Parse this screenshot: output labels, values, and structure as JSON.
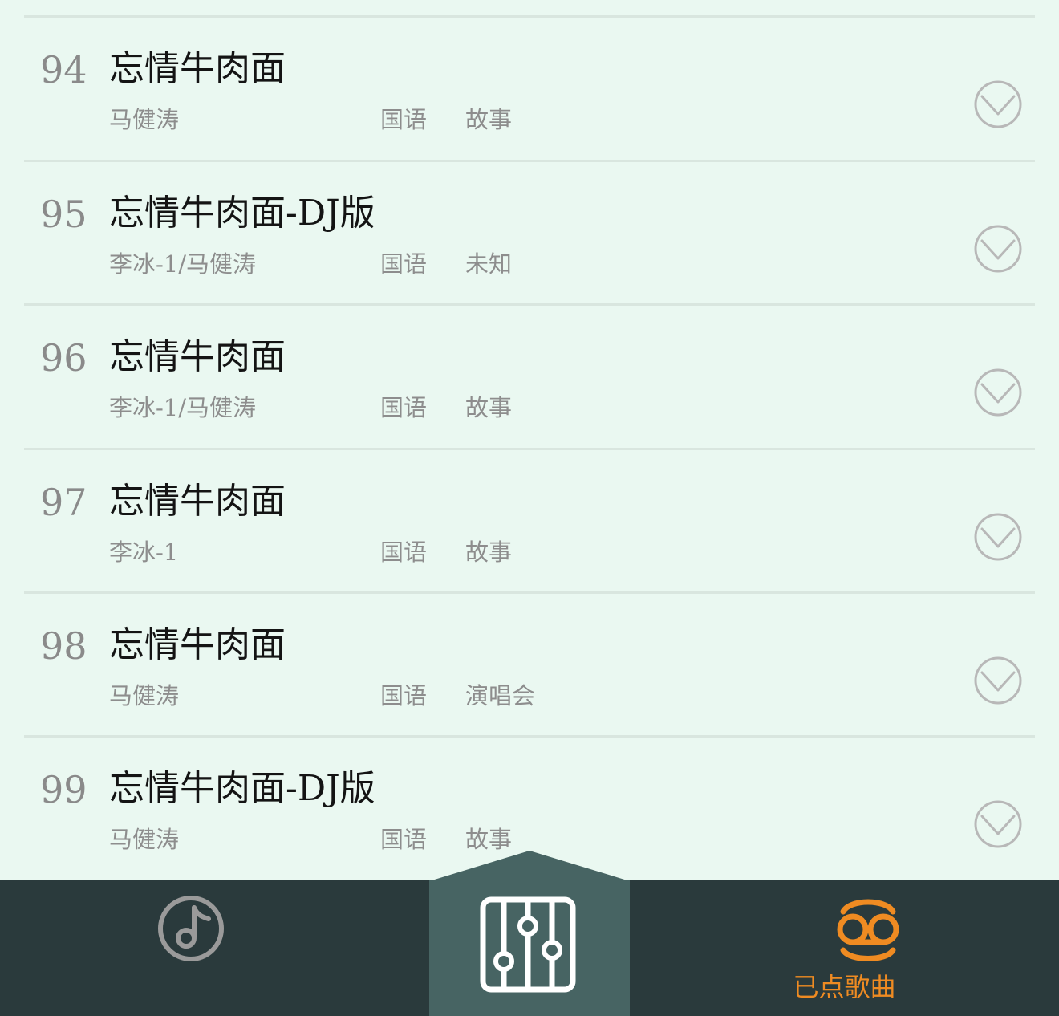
{
  "songs": [
    {
      "num": "94",
      "title": "忘情牛肉面",
      "artist": "马健涛",
      "language": "国语",
      "tag": "故事"
    },
    {
      "num": "95",
      "title": "忘情牛肉面-DJ版",
      "artist": "李冰-1/马健涛",
      "language": "国语",
      "tag": "未知"
    },
    {
      "num": "96",
      "title": "忘情牛肉面",
      "artist": "李冰-1/马健涛",
      "language": "国语",
      "tag": "故事"
    },
    {
      "num": "97",
      "title": "忘情牛肉面",
      "artist": "李冰-1",
      "language": "国语",
      "tag": "故事"
    },
    {
      "num": "98",
      "title": "忘情牛肉面",
      "artist": "马健涛",
      "language": "国语",
      "tag": "演唱会"
    },
    {
      "num": "99",
      "title": "忘情牛肉面-DJ版",
      "artist": "马健涛",
      "language": "国语",
      "tag": "故事"
    }
  ],
  "tabs": {
    "songs": {
      "label": "",
      "icon": "music-note-icon",
      "color": "#9a9a9a"
    },
    "center": {
      "icon": "equalizer-icon",
      "color": "#ffffff"
    },
    "queue": {
      "label": "已点歌曲",
      "icon": "queue-tape-icon",
      "color": "#ef8b22"
    }
  },
  "colors": {
    "background": "#eaf8f1",
    "bar": "#2a3a3c",
    "center_tab": "#476463",
    "accent": "#ef8b22",
    "check": "#b8b8b8"
  }
}
